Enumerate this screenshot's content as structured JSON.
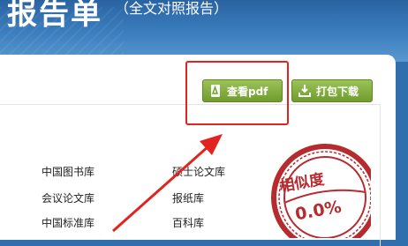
{
  "header": {
    "title": "报告单",
    "subtitle": "（全文对照报告）"
  },
  "toolbar": {
    "view_pdf_label": "查看pdf",
    "pack_download_label": "打包下载"
  },
  "categories": [
    "中国图书库",
    "硕士论文库",
    "会议论文库",
    "报纸库",
    "中国标准库",
    "百科库"
  ],
  "seal": {
    "label": "相似度",
    "value": "0.0%"
  },
  "colors": {
    "header_blue": "#3c7fbf",
    "button_green": "#7fae3c",
    "highlight_red": "#e3231f",
    "seal_red": "#b72a2e"
  }
}
